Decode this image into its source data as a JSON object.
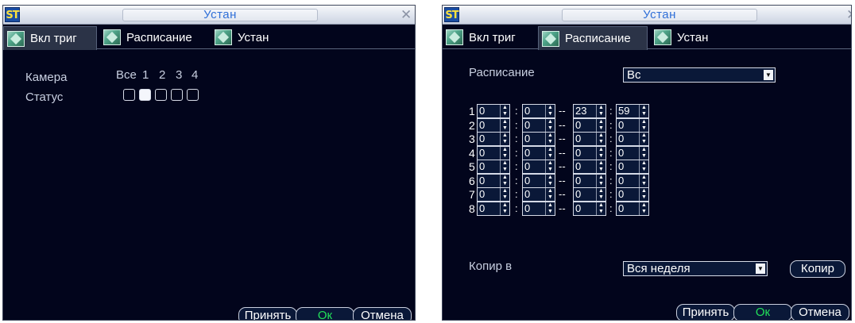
{
  "left": {
    "title": "Устан",
    "tabs": [
      {
        "label": "Вкл триг",
        "icon": "settings-tab-icon"
      },
      {
        "label": "Расписание",
        "icon": "settings-tab-icon"
      },
      {
        "label": "Устан",
        "icon": "settings-tab-icon"
      }
    ],
    "active_tab": "Вкл триг",
    "camera_label": "Камера",
    "status_label": "Статус",
    "camera_options": [
      "Все",
      "1",
      "2",
      "3",
      "4"
    ],
    "status_checked": [
      false,
      true,
      false,
      false,
      false
    ],
    "buttons": {
      "apply": "Принять",
      "ok": "Ок",
      "cancel": "Отмена"
    }
  },
  "right": {
    "title": "Устан",
    "tabs": [
      {
        "label": "Вкл триг",
        "icon": "settings-tab-icon"
      },
      {
        "label": "Расписание",
        "icon": "settings-tab-icon"
      },
      {
        "label": "Устан",
        "icon": "settings-tab-icon"
      }
    ],
    "active_tab": "Расписание",
    "schedule_label": "Расписание",
    "schedule_value": "Вс",
    "rows": [
      {
        "num": "1",
        "start_h": "0",
        "start_m": "0",
        "end_h": "23",
        "end_m": "59"
      },
      {
        "num": "2",
        "start_h": "0",
        "start_m": "0",
        "end_h": "0",
        "end_m": "0"
      },
      {
        "num": "3",
        "start_h": "0",
        "start_m": "0",
        "end_h": "0",
        "end_m": "0"
      },
      {
        "num": "4",
        "start_h": "0",
        "start_m": "0",
        "end_h": "0",
        "end_m": "0"
      },
      {
        "num": "5",
        "start_h": "0",
        "start_m": "0",
        "end_h": "0",
        "end_m": "0"
      },
      {
        "num": "6",
        "start_h": "0",
        "start_m": "0",
        "end_h": "0",
        "end_m": "0"
      },
      {
        "num": "7",
        "start_h": "0",
        "start_m": "0",
        "end_h": "0",
        "end_m": "0"
      },
      {
        "num": "8",
        "start_h": "0",
        "start_m": "0",
        "end_h": "0",
        "end_m": "0"
      }
    ],
    "copy_label": "Копир в",
    "copy_value": "Вся неделя",
    "copy_button": "Копир",
    "buttons": {
      "apply": "Принять",
      "ok": "Ок",
      "cancel": "Отмена"
    },
    "separators": {
      "colon": ":",
      "dash": "--"
    }
  },
  "colors": {
    "panel": "#02051c",
    "title_text": "#2f6fd8",
    "ok_text": "#22e05a"
  }
}
